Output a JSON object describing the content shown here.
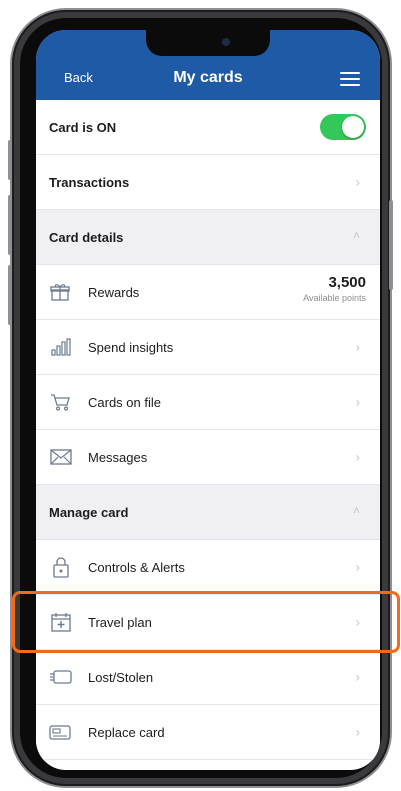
{
  "header": {
    "back_label": "Back",
    "title": "My cards"
  },
  "card_status": {
    "label": "Card is ON",
    "toggle_on": true,
    "toggle_color": "#34c759"
  },
  "transactions": {
    "label": "Transactions"
  },
  "card_details": {
    "section_label": "Card details",
    "rewards": {
      "label": "Rewards",
      "points": "3,500",
      "caption": "Available points"
    },
    "spend_insights": {
      "label": "Spend insights"
    },
    "cards_on_file": {
      "label": "Cards on file"
    },
    "messages": {
      "label": "Messages"
    }
  },
  "manage_card": {
    "section_label": "Manage card",
    "controls_alerts": {
      "label": "Controls & Alerts"
    },
    "travel_plan": {
      "label": "Travel plan"
    },
    "lost_stolen": {
      "label": "Lost/Stolen"
    },
    "replace_card": {
      "label": "Replace card"
    }
  },
  "colors": {
    "header": "#1f5aa6",
    "highlight": "#f26b1d",
    "toggle": "#34c759"
  },
  "icons": [
    "rewards-icon",
    "bar-chart-icon",
    "cart-icon",
    "envelope-icon",
    "lock-icon",
    "calendar-plus-icon",
    "card-stolen-icon",
    "card-replace-icon"
  ]
}
